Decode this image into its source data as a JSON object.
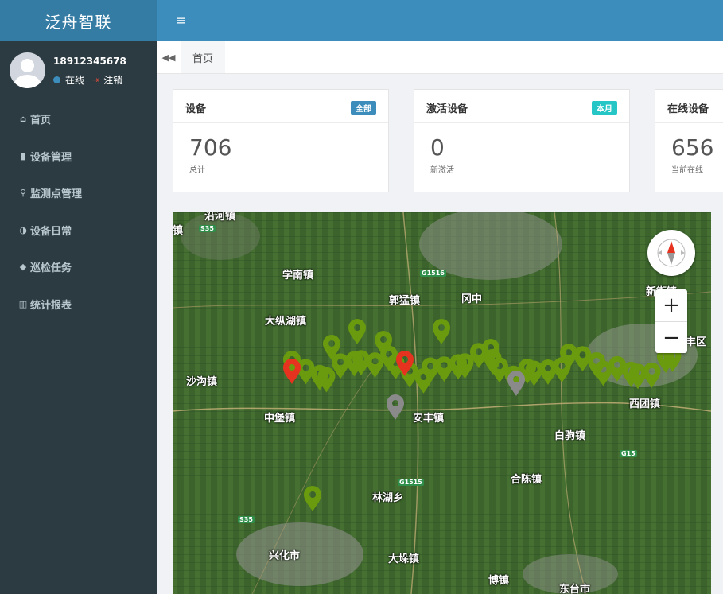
{
  "app": {
    "title": "泛舟智联"
  },
  "user": {
    "phone": "18912345678",
    "status": "在线",
    "logout": "注销"
  },
  "menu": [
    {
      "label": "首页",
      "icon": "home-icon",
      "glyph": "⌂"
    },
    {
      "label": "设备管理",
      "icon": "device-icon",
      "glyph": "▮"
    },
    {
      "label": "监测点管理",
      "icon": "map-marker-icon",
      "glyph": "⚲"
    },
    {
      "label": "设备日常",
      "icon": "adjust-icon",
      "glyph": "◑"
    },
    {
      "label": "巡检任务",
      "icon": "tags-icon",
      "glyph": "◆"
    },
    {
      "label": "统计报表",
      "icon": "bar-chart-icon",
      "glyph": "▥"
    }
  ],
  "tabs": {
    "active": "首页"
  },
  "cards": [
    {
      "title": "设备",
      "badge": "全部",
      "badge_color": "#3c8dbc",
      "value": "706",
      "sub": "总计"
    },
    {
      "title": "激活设备",
      "badge": "本月",
      "badge_color": "#26c6c6",
      "value": "0",
      "sub": "新激活"
    },
    {
      "title": "在线设备",
      "badge": "",
      "badge_color": "",
      "value": "656",
      "sub": "当前在线"
    }
  ],
  "map": {
    "places": [
      "沿河镇",
      "学南镇",
      "郭猛镇",
      "冈中",
      "大纵湖镇",
      "沙沟镇",
      "中堡镇",
      "安丰镇",
      "白驹镇",
      "西团镇",
      "合陈镇",
      "林湖乡",
      "兴化市",
      "大垛镇",
      "博镇",
      "东台市",
      "新街镇",
      "丰区",
      "镇"
    ],
    "road_signs": [
      "S35",
      "G1516",
      "G1515",
      "G15",
      "S35"
    ],
    "zoom_in": "+",
    "zoom_out": "−",
    "marker_colors": {
      "normal": "#6a9a0e",
      "alarm": "#e53320",
      "offline": "#8a8a8a"
    }
  }
}
